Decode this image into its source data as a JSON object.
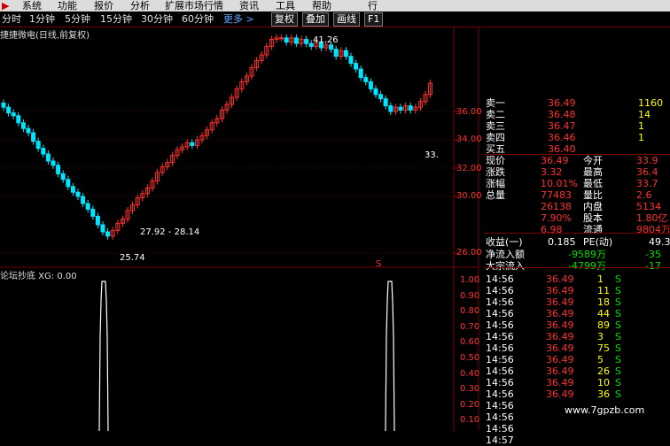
{
  "menubar": {
    "items": [
      "系统",
      "功能",
      "报价",
      "分析",
      "扩展市场行情",
      "资讯",
      "工具",
      "帮助",
      "行"
    ]
  },
  "toolbar": {
    "periods": [
      "分时",
      "1分钟",
      "5分钟",
      "15分钟",
      "30分钟",
      "60分钟"
    ],
    "more": "更多 >",
    "buttons": [
      "复权",
      "叠加",
      "画线",
      "F1"
    ]
  },
  "chart_title": "捷捷微电(日线,前复权)",
  "price_axis": {
    "ticks": [
      "36.00",
      "34.00",
      "32.00",
      "30.00",
      "26.00"
    ]
  },
  "annotations": {
    "high": "41.26",
    "low": "25.74",
    "range": "27.92 - 28.14",
    "last": "33."
  },
  "indicator": {
    "title": "论坛抄底 XG: 0.00",
    "ticks": [
      "1.00",
      "0.90",
      "0.80",
      "0.70",
      "0.60",
      "0.50",
      "0.40",
      "0.30",
      "0.20",
      "0.10"
    ],
    "marker": "S"
  },
  "quote_panel": {
    "order_book": [
      {
        "label": "卖一",
        "price": "36.49",
        "vol": "1160"
      },
      {
        "label": "卖二",
        "price": "36.48",
        "vol": "14"
      },
      {
        "label": "卖三",
        "price": "36.47",
        "vol": "1"
      },
      {
        "label": "卖四",
        "price": "36.46",
        "vol": "1"
      },
      {
        "label": "买五",
        "price": "36.40",
        "vol": ""
      }
    ],
    "stats": [
      {
        "l1": "现价",
        "v1": "36.49",
        "l2": "今开",
        "v2": "33.9"
      },
      {
        "l1": "涨跌",
        "v1": "3.32",
        "l2": "最高",
        "v2": "36.4"
      },
      {
        "l1": "涨幅",
        "v1": "10.01%",
        "l2": "最低",
        "v2": "33.7"
      },
      {
        "l1": "总量",
        "v1": "77483",
        "l2": "量比",
        "v2": "2.6"
      },
      {
        "l1": "",
        "v1": "26138",
        "l2": "内盘",
        "v2": "5134"
      },
      {
        "l1": "",
        "v1": "7.90%",
        "l2": "股本",
        "v2": "1.80亿"
      },
      {
        "l1": "",
        "v1": "6.98",
        "l2": "流通",
        "v2": "9804万"
      }
    ],
    "income": {
      "label": "收益(一)",
      "v1": "0.185",
      "label2": "PE(动)",
      "v2": "49.3"
    },
    "flows": [
      {
        "label": "净流入额",
        "v1": "-9589万",
        "v2": "-35"
      },
      {
        "label": "大宗流入",
        "v1": "-4799万",
        "v2": "-17"
      }
    ],
    "ticks": [
      {
        "time": "14:56",
        "price": "36.49",
        "vol": "1",
        "side": "S"
      },
      {
        "time": "14:56",
        "price": "36.49",
        "vol": "11",
        "side": "S"
      },
      {
        "time": "14:56",
        "price": "36.49",
        "vol": "18",
        "side": "S"
      },
      {
        "time": "14:56",
        "price": "36.49",
        "vol": "44",
        "side": "S"
      },
      {
        "time": "14:56",
        "price": "36.49",
        "vol": "89",
        "side": "S"
      },
      {
        "time": "14:56",
        "price": "36.49",
        "vol": "3",
        "side": "S"
      },
      {
        "time": "14:56",
        "price": "36.49",
        "vol": "75",
        "side": "S"
      },
      {
        "time": "14:56",
        "price": "36.49",
        "vol": "5",
        "side": "S"
      },
      {
        "time": "14:56",
        "price": "36.49",
        "vol": "26",
        "side": "S"
      },
      {
        "time": "14:56",
        "price": "36.49",
        "vol": "10",
        "side": "S"
      },
      {
        "time": "14:56",
        "price": "36.49",
        "vol": "36",
        "side": "S"
      },
      {
        "time": "14:56",
        "price": "",
        "vol": "",
        "side": ""
      },
      {
        "time": "14:56",
        "price": "",
        "vol": "",
        "side": ""
      },
      {
        "time": "14:56",
        "price": "",
        "vol": "",
        "side": ""
      },
      {
        "time": "14:57",
        "price": "",
        "vol": "",
        "side": ""
      }
    ]
  },
  "watermark": "www.7gpzb.com",
  "colors": {
    "up": "#ff3030",
    "down": "#00e5ff",
    "grid": "#7a0000",
    "panel_price": "#ff3030"
  }
}
